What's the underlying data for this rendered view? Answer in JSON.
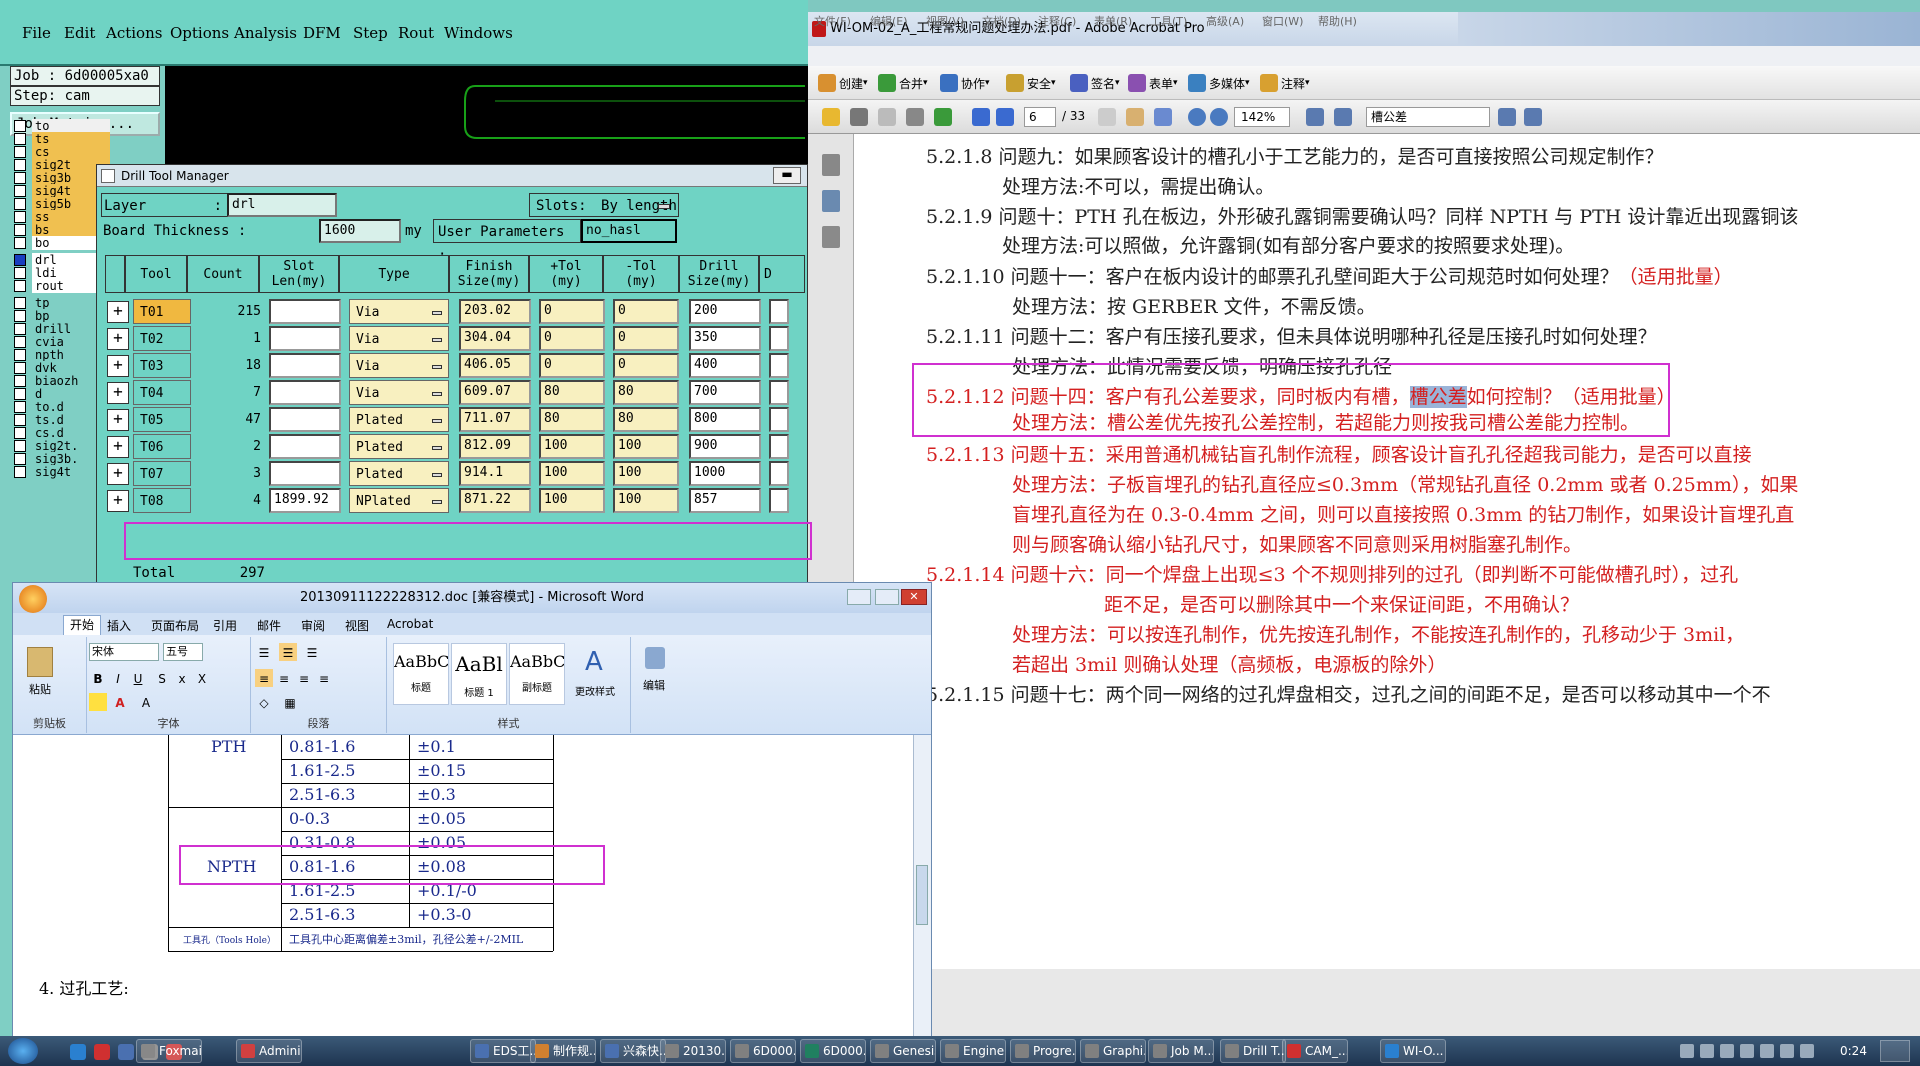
{
  "cam": {
    "menu": [
      "File",
      "Edit",
      "Actions",
      "Options",
      "Analysis",
      "DFM",
      "Step",
      "Rout",
      "Windows"
    ],
    "job_label": "Job : 6d00005xa0",
    "step_label": "Step: cam",
    "job_matrix_label": "Job Matrix ...",
    "layers": [
      "to",
      "ts",
      "cs",
      "sig2t",
      "sig3b",
      "sig4t",
      "sig5b",
      "ss",
      "bs",
      "bo",
      "drl",
      "ldi",
      "rout",
      "tp",
      "bp",
      "drill",
      "cvia",
      "npth",
      "dvk",
      "biaozh",
      "d",
      "to.d",
      "ts.d",
      "cs.d",
      "sig2t.",
      "sig3b.",
      "sig4t"
    ]
  },
  "dtm": {
    "title": "Drill Tool Manager",
    "layer_label": "Layer",
    "layer_value": "drl",
    "slots_label": "Slots:",
    "slots_value": "By length",
    "board_thickness_label": "Board Thickness :",
    "board_thickness_value": "1600",
    "board_thickness_unit": "my",
    "user_params_label": "User Parameters :",
    "user_params_value": "no_hasl",
    "headers": {
      "tool": "Tool",
      "count": "Count",
      "slot1": "Slot",
      "slot2": "Len(my)",
      "type": "Type",
      "fin1": "Finish",
      "fin2": "Size(my)",
      "ptol1": "+Tol",
      "ptol2": "(my)",
      "mtol1": "-Tol",
      "mtol2": "(my)",
      "drill1": "Drill",
      "drill2": "Size(my)",
      "d": "D"
    },
    "rows": [
      {
        "tool": "T01",
        "count": "215",
        "slot": "",
        "type": "Via",
        "finish": "203.02",
        "ptol": "0",
        "mtol": "0",
        "drill": "200"
      },
      {
        "tool": "T02",
        "count": "1",
        "slot": "",
        "type": "Via",
        "finish": "304.04",
        "ptol": "0",
        "mtol": "0",
        "drill": "350"
      },
      {
        "tool": "T03",
        "count": "18",
        "slot": "",
        "type": "Via",
        "finish": "406.05",
        "ptol": "0",
        "mtol": "0",
        "drill": "400"
      },
      {
        "tool": "T04",
        "count": "7",
        "slot": "",
        "type": "Via",
        "finish": "609.07",
        "ptol": "80",
        "mtol": "80",
        "drill": "700"
      },
      {
        "tool": "T05",
        "count": "47",
        "slot": "",
        "type": "Plated",
        "finish": "711.07",
        "ptol": "80",
        "mtol": "80",
        "drill": "800"
      },
      {
        "tool": "T06",
        "count": "2",
        "slot": "",
        "type": "Plated",
        "finish": "812.09",
        "ptol": "100",
        "mtol": "100",
        "drill": "900"
      },
      {
        "tool": "T07",
        "count": "3",
        "slot": "",
        "type": "Plated",
        "finish": "914.1",
        "ptol": "100",
        "mtol": "100",
        "drill": "1000"
      },
      {
        "tool": "T08",
        "count": "4",
        "slot": "1899.92",
        "type": "NPlated",
        "finish": "871.22",
        "ptol": "100",
        "mtol": "100",
        "drill": "857"
      }
    ],
    "total_label": "Total",
    "total_value": "297"
  },
  "acrobat": {
    "title": "WI-OM-02_A_工程常规问题处理办法.pdf - Adobe Acrobat Pro",
    "menu": [
      "文件(F)",
      "编辑(E)",
      "视图(V)",
      "文档(D)",
      "注释(C)",
      "表单(R)",
      "工具(T)",
      "高级(A)",
      "窗口(W)",
      "帮助(H)"
    ],
    "toolbar1": [
      "创建",
      "合并",
      "协作",
      "安全",
      "签名",
      "表单",
      "多媒体",
      "注释"
    ],
    "page_current": "6",
    "page_total": "/ 33",
    "zoom": "142%",
    "search_value": "槽公差",
    "lines": [
      {
        "text": "5.2.1.8  问题九：如果顾客设计的槽孔小于工艺能力的，是否可直接按照公司规定制作？",
        "red": false
      },
      {
        "text": "处理方法:不可以，需提出确认。",
        "red": false
      },
      {
        "text": "5.2.1.9  问题十：PTH 孔在板边，外形破孔露铜需要确认吗？同样 NPTH 与 PTH 设计靠近出现露铜该",
        "red": false
      },
      {
        "text": "处理方法:可以照做，允许露铜(如有部分客户要求的按照要求处理)。",
        "red": false
      },
      {
        "text": "5.2.1.10  问题十一：客户在板内设计的邮票孔孔壁间距大于公司规范时如何处理？",
        "red": false
      },
      {
        "text": "（适用批量）",
        "red": true
      },
      {
        "text": "处理方法：按 GERBER 文件，不需反馈。",
        "red": false
      },
      {
        "text": "5.2.1.11  问题十二：客户有压接孔要求，但未具体说明哪种孔径是压接孔时如何处理？",
        "red": false
      },
      {
        "text": "处理方法：此情况需要反馈，明确压接孔孔径",
        "red": false
      },
      {
        "text": "5.2.1.12  问题十四：客户有孔公差要求，同时板内有槽，",
        "red": true
      },
      {
        "text": "槽公差",
        "red": true
      },
      {
        "text": "如何控制？（适用批量）",
        "red": true
      },
      {
        "text": "处理方法：槽公差优先按孔公差控制，若超能力则按我司槽公差能力控制。",
        "red": true
      },
      {
        "text": "5.2.1.13  问题十五：采用普通机械钻盲孔制作流程，顾客设计盲孔孔径超我司能力，是否可以直接",
        "red": true
      },
      {
        "text": "处理方法：子板盲埋孔的钻孔直径应≤0.3mm（常规钻孔直径 0.2mm 或者 0.25mm），如果",
        "red": true
      },
      {
        "text": "盲埋孔直径为在 0.3-0.4mm 之间，则可以直接按照 0.3mm 的钻刀制作，如果设计盲埋孔直",
        "red": true
      },
      {
        "text": "则与顾客确认缩小钻孔尺寸，如果顾客不同意则采用树脂塞孔制作。",
        "red": true
      },
      {
        "text": "5.2.1.14  问题十六：同一个焊盘上出现≤3 个不规则排列的过孔（即判断不可能做槽孔时），过孔",
        "red": true
      },
      {
        "text": "距不足，是否可以删除其中一个来保证间距，不用确认？",
        "red": true
      },
      {
        "text": "处理方法：可以按连孔制作，优先按连孔制作，不能按连孔制作的，孔移动少于 3mil，",
        "red": true
      },
      {
        "text": "若超出 3mil 则确认处理（高频板，电源板的除外）",
        "red": true
      },
      {
        "text": "5.2.1.15  问题十七：两个同一网络的过孔焊盘相交，过孔之间的间距不足，是否可以移动其中一个不",
        "red": false
      }
    ]
  },
  "word": {
    "title": "20130911122228312.doc [兼容模式] - Microsoft Word",
    "tabs": [
      "开始",
      "插入",
      "页面布局",
      "引用",
      "邮件",
      "审阅",
      "视图",
      "Acrobat"
    ],
    "font_name": "宋体",
    "font_size": "五号",
    "groups": [
      "剪贴板",
      "字体",
      "段落",
      "样式"
    ],
    "paste_label": "粘贴",
    "styles": [
      {
        "sample": "AaBbC",
        "label": "标题"
      },
      {
        "sample": "AaBl",
        "label": "标题 1"
      },
      {
        "sample": "AaBbC",
        "label": "副标题"
      }
    ],
    "change_styles_label": "更改样式",
    "edit_label": "编辑",
    "table": {
      "pth_label": "PTH",
      "npth_label": "NPTH",
      "pth_rows": [
        [
          "0.81-1.6",
          "±0.1"
        ],
        [
          "1.61-2.5",
          "±0.15"
        ],
        [
          "2.51-6.3",
          "±0.3"
        ]
      ],
      "npth_rows": [
        [
          "0-0.3",
          "±0.05"
        ],
        [
          "0.31-0.8",
          "±0.05"
        ],
        [
          "0.81-1.6",
          "±0.08"
        ],
        [
          "1.61-2.5",
          "+0.1/-0"
        ],
        [
          "2.51-6.3",
          "+0.3-0"
        ]
      ],
      "tool_hole_label": "工具孔（Tools Hole）",
      "tool_hole_text": "工具孔中心距离偏差±3mil，孔径公差+/-2MIL"
    },
    "bottom_text": "4.  过孔工艺:"
  },
  "taskbar": {
    "items": [
      "Foxmail",
      "Admini...",
      "",
      "",
      "",
      "",
      "EDS工...",
      "制作规...",
      "兴森快...",
      "20130...",
      "6D000...",
      "6D000...",
      "Genesis",
      "Engine...",
      "Progre...",
      "Graphi...",
      "Job M...",
      "Drill T...",
      "CAM_...",
      "WI-O..."
    ],
    "time": "0:24"
  },
  "colors": {
    "cam_bg": "#6fd3c4",
    "highlight": "#d030d0",
    "red_text": "#d42020"
  }
}
